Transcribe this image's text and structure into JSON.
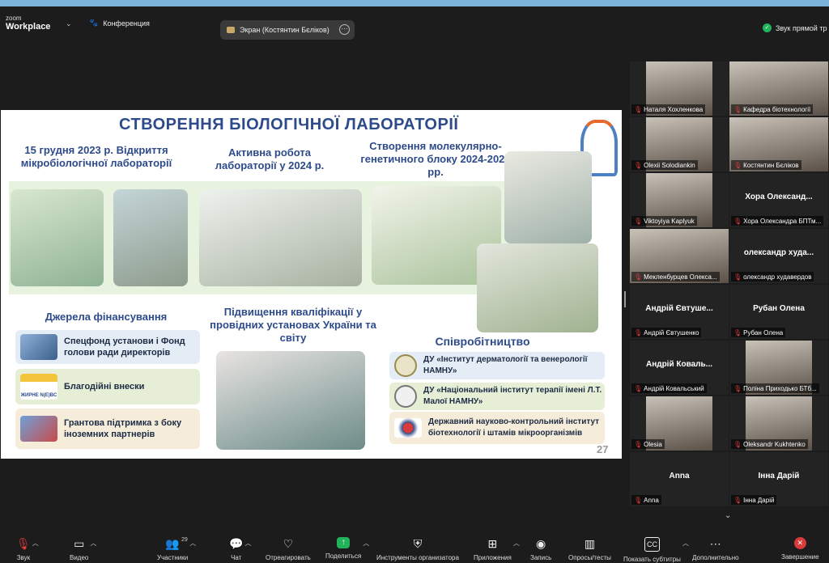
{
  "app": {
    "logo_line1": "zoom",
    "logo_line2": "Workplace",
    "meeting_label": "Конференция"
  },
  "screen_share": {
    "label": "Экран (Костянтин Бєліков)"
  },
  "audio_status": "Звук прямой тр",
  "slide": {
    "title": "СТВОРЕННЯ БІОЛОГІЧНОЇ ЛАБОРАТОРІЇ",
    "col1_heading": "15 грудня 2023 р. Відкриття мікробіологічної лабораторії",
    "col2_heading": "Активна робота лабораторії у 2024 р.",
    "col3_heading": "Створення молекулярно-генетичного блоку 2024-2025 рр.",
    "funding_heading": "Джерела фінансування",
    "funding_items": [
      "Спецфонд установи і Фонд голови ради директорів",
      "Благодійні внески",
      "Грантова підтримка з боку іноземних партнерів"
    ],
    "funding_logo_text": "ЖИРНЕ N(E)BC",
    "training_heading": "Підвищення кваліфікації у провідних установах України та світу",
    "coop_heading": "Співробітництво",
    "coop_items": [
      "ДУ «Інститут дерматології та венерології НАМНУ»",
      "ДУ «Національний інститут терапії імені Л.Т. Малої НАМНУ»",
      "Державний науково-контрольний інститут біотехнології і штамів мікроорганізмів"
    ],
    "page_number": "27"
  },
  "participants": [
    {
      "name": "Наталя Хохленкова",
      "video": true
    },
    {
      "name": "Кафедра біотехнології",
      "video": true
    },
    {
      "name": "Olexii Solodiankin",
      "video": true
    },
    {
      "name": "Костянтин Бєліков",
      "video": true,
      "active": true
    },
    {
      "name": "Viktoyiya Kaplyuk",
      "video": true
    },
    {
      "name": "Хора Олександра БПТм...",
      "display": "Хора Олександ...",
      "video": false
    },
    {
      "name": "Мекленбурцев Олекса...",
      "video": true
    },
    {
      "name": "олександр худавердов",
      "display": "олександр худа...",
      "video": false
    },
    {
      "name": "Андрій Євтушенко",
      "display": "Андрій Євтуше...",
      "video": false
    },
    {
      "name": "Рубан Олена",
      "display": "Рубан Олена",
      "video": false
    },
    {
      "name": "Андрій Ковальський",
      "display": "Андрій Коваль...",
      "video": false
    },
    {
      "name": "Поліна Приходько БТб...",
      "video": true
    },
    {
      "name": "Olesia",
      "video": true
    },
    {
      "name": "Oleksandr Kukhtenko",
      "video": true
    },
    {
      "name": "Anna",
      "display": "Anna",
      "video": false
    },
    {
      "name": "Інна Дарій",
      "display": "Інна Дарій",
      "video": false
    }
  ],
  "toolbar": {
    "audio": "Звук",
    "video": "Видео",
    "participants": "Участники",
    "participants_count": "29",
    "chat": "Чат",
    "react": "Отреагировать",
    "share": "Поделиться",
    "host_tools": "Инструменты организатора",
    "apps": "Приложения",
    "record": "Запись",
    "polls": "Опросы/тесты",
    "captions": "Показать субтитры",
    "more": "Дополнительно",
    "end": "Завершение"
  },
  "colors": {
    "accent_green": "#21b35a",
    "end_red": "#d93a3a",
    "slide_title": "#2d4b8a"
  }
}
